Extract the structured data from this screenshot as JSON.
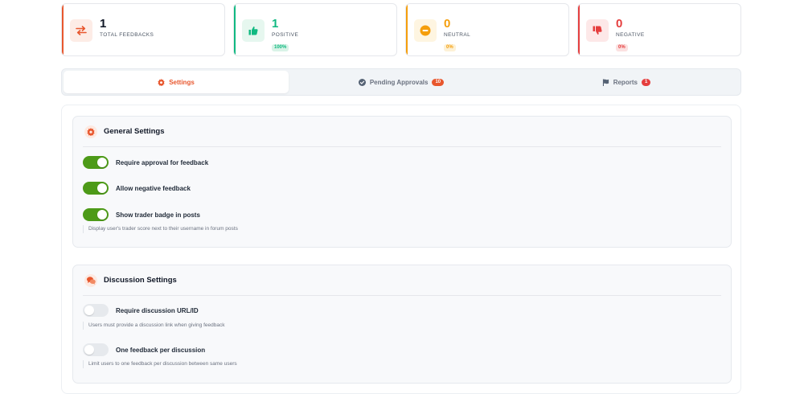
{
  "stats": [
    {
      "value": "1",
      "label": "TOTAL FEEDBACKS",
      "badge": "",
      "color": "#e8572e",
      "bg": "#fdece6",
      "icon": "arrows-exchange-icon"
    },
    {
      "value": "1",
      "label": "POSITIVE",
      "badge": "100%",
      "color": "#10b981",
      "bg": "#e6f7ef",
      "icon": "thumbs-up-icon"
    },
    {
      "value": "0",
      "label": "NEUTRAL",
      "badge": "0%",
      "color": "#f59e0b",
      "bg": "#fef5e1",
      "icon": "minus-circle-icon"
    },
    {
      "value": "0",
      "label": "NEGATIVE",
      "badge": "0%",
      "color": "#e53e3e",
      "bg": "#fde8e8",
      "icon": "thumbs-down-icon"
    }
  ],
  "tabs": {
    "settings": "Settings",
    "pending": "Pending Approvals",
    "pending_count": "10",
    "reports": "Reports",
    "reports_count": "1"
  },
  "general": {
    "title": "General Settings",
    "items": [
      {
        "label": "Require approval for feedback",
        "on": true
      },
      {
        "label": "Allow negative feedback",
        "on": true
      },
      {
        "label": "Show trader badge in posts",
        "on": true
      }
    ],
    "hint": "Display user's trader score next to their username in forum posts"
  },
  "discussion": {
    "title": "Discussion Settings",
    "items": [
      {
        "label": "Require discussion URL/ID",
        "on": false,
        "hint": "Users must provide a discussion link when giving feedback"
      },
      {
        "label": "One feedback per discussion",
        "on": false,
        "hint": "Limit users to one feedback per discussion between same users"
      }
    ]
  }
}
